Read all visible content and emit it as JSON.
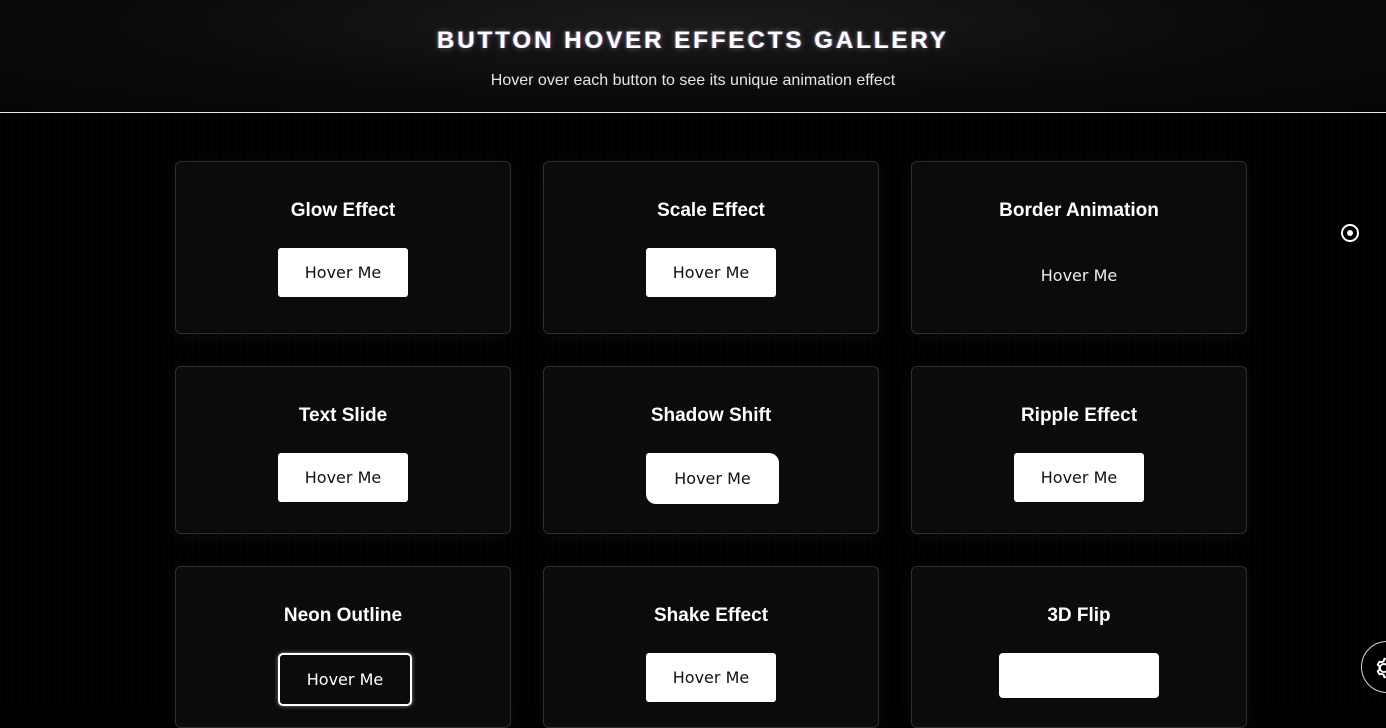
{
  "header": {
    "title": "BUTTON HOVER EFFECTS GALLERY",
    "subtitle": "Hover over each button to see its unique animation effect"
  },
  "cards": [
    {
      "title": "Glow Effect",
      "button_label": "Hover Me"
    },
    {
      "title": "Scale Effect",
      "button_label": "Hover Me"
    },
    {
      "title": "Border Animation",
      "button_label": "Hover Me"
    },
    {
      "title": "Text Slide",
      "button_label": "Hover Me"
    },
    {
      "title": "Shadow Shift",
      "button_label": "Hover Me"
    },
    {
      "title": "Ripple Effect",
      "button_label": "Hover Me"
    },
    {
      "title": "Neon Outline",
      "button_label": "Hover Me"
    },
    {
      "title": "Shake Effect",
      "button_label": "Hover Me"
    },
    {
      "title": "3D Flip",
      "button_label": ""
    }
  ],
  "floating": {
    "radio_icon": "radio-dot-icon",
    "settings_icon": "gear-icon"
  },
  "colors": {
    "background": "#000000",
    "card_background": "#0b0b0b",
    "card_border": "#2e2e2e",
    "button_background": "#ffffff",
    "button_text": "#111111",
    "header_rule": "#e8e8e8"
  }
}
